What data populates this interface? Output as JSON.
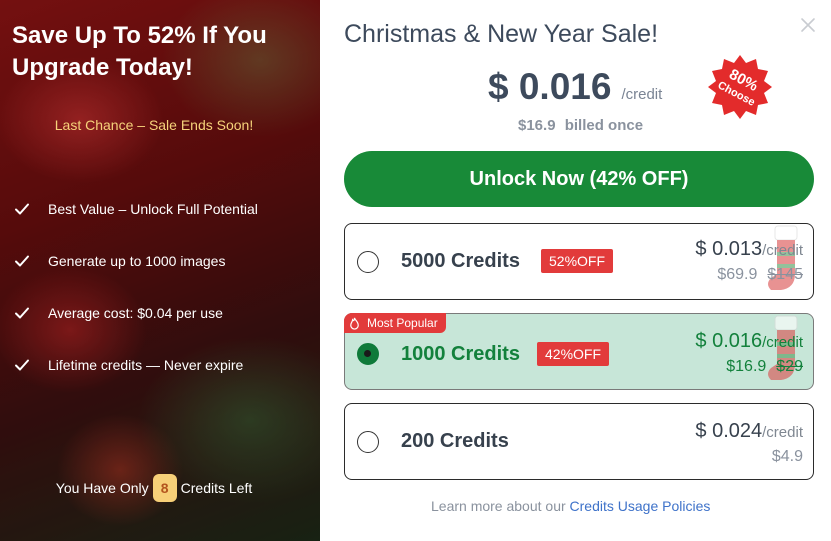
{
  "promo": {
    "title": "Save Up To 52% If You Upgrade Today!",
    "subtitle": "Last Chance – Sale Ends Soon!",
    "features": [
      "Best Value – Unlock Full Potential",
      "Generate up to 1000 images",
      "Average cost: $0.04 per use",
      "Lifetime credits — Never expire"
    ],
    "credits_left_prefix": "You Have Only",
    "credits_left_count": "8",
    "credits_left_suffix": "Credits Left"
  },
  "sale": {
    "title": "Christmas & New Year Sale!",
    "price": "$ 0.016",
    "unit": "/credit",
    "billed_amount": "$16.9",
    "billed_text": "billed once",
    "seal_line1": "80%",
    "seal_line2": "Choose",
    "cta_label": "Unlock Now (42% OFF)"
  },
  "plans": [
    {
      "name": "5000 Credits",
      "off": "52%OFF",
      "price": "$ 0.013",
      "unit": "/credit",
      "billed": "$69.9",
      "original": "$145",
      "selected": false
    },
    {
      "name": "1000 Credits",
      "off": "42%OFF",
      "price": "$ 0.016",
      "unit": "/credit",
      "billed": "$16.9",
      "original": "$29",
      "selected": true,
      "badge": "Most Popular"
    },
    {
      "name": "200 Credits",
      "price": "$ 0.024",
      "unit": "/credit",
      "billed": "$4.9",
      "selected": false
    }
  ],
  "footer": {
    "text": "Learn more about our",
    "link": "Credits Usage Policies"
  },
  "colors": {
    "accent_green": "#188a38",
    "discount_red": "#e23b3b",
    "selected_bg": "#c7e6d8",
    "highlight_yellow": "#f6d27a"
  },
  "icons": {
    "close": "close-icon",
    "check": "check-icon",
    "fire": "fire-icon",
    "stocking": "stocking-icon",
    "seal": "seal-badge"
  }
}
